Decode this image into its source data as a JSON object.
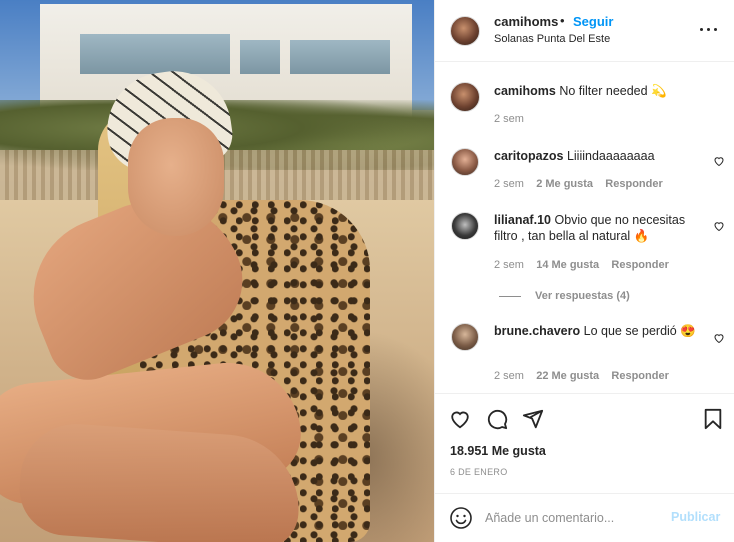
{
  "post": {
    "username": "camihoms",
    "follow_label": "Seguir",
    "dot": "•",
    "location": "Solanas Punta Del Este",
    "more_icon": "more-horizontal-icon",
    "caption": {
      "username": "camihoms",
      "text": "No filter needed 💫",
      "time": "2 sem"
    },
    "comments": [
      {
        "username": "caritopazos",
        "text": "Liiiindaaaaaaaa",
        "time": "2 sem",
        "likes": "2 Me gusta",
        "reply": "Responder"
      },
      {
        "username": "lilianaf.10",
        "text": "Obvio que no necesitas filtro , tan bella al natural 🔥",
        "time": "2 sem",
        "likes": "14 Me gusta",
        "reply": "Responder"
      },
      {
        "username": "brune.chavero",
        "text": "Lo que se perdió 😍",
        "time": "2 sem",
        "likes": "22 Me gusta",
        "reply": "Responder"
      }
    ],
    "view_replies": "Ver respuestas (4)",
    "like_count": "18.951 Me gusta",
    "date": "6 DE ENERO",
    "compose": {
      "emoji_icon": "smiley-icon",
      "placeholder": "Añade un comentario...",
      "publish_label": "Publicar"
    },
    "colors": {
      "link_blue": "#0095f6",
      "publish_disabled": "#b2dffc",
      "meta_gray": "#8e8e8e",
      "text": "#262626"
    }
  }
}
